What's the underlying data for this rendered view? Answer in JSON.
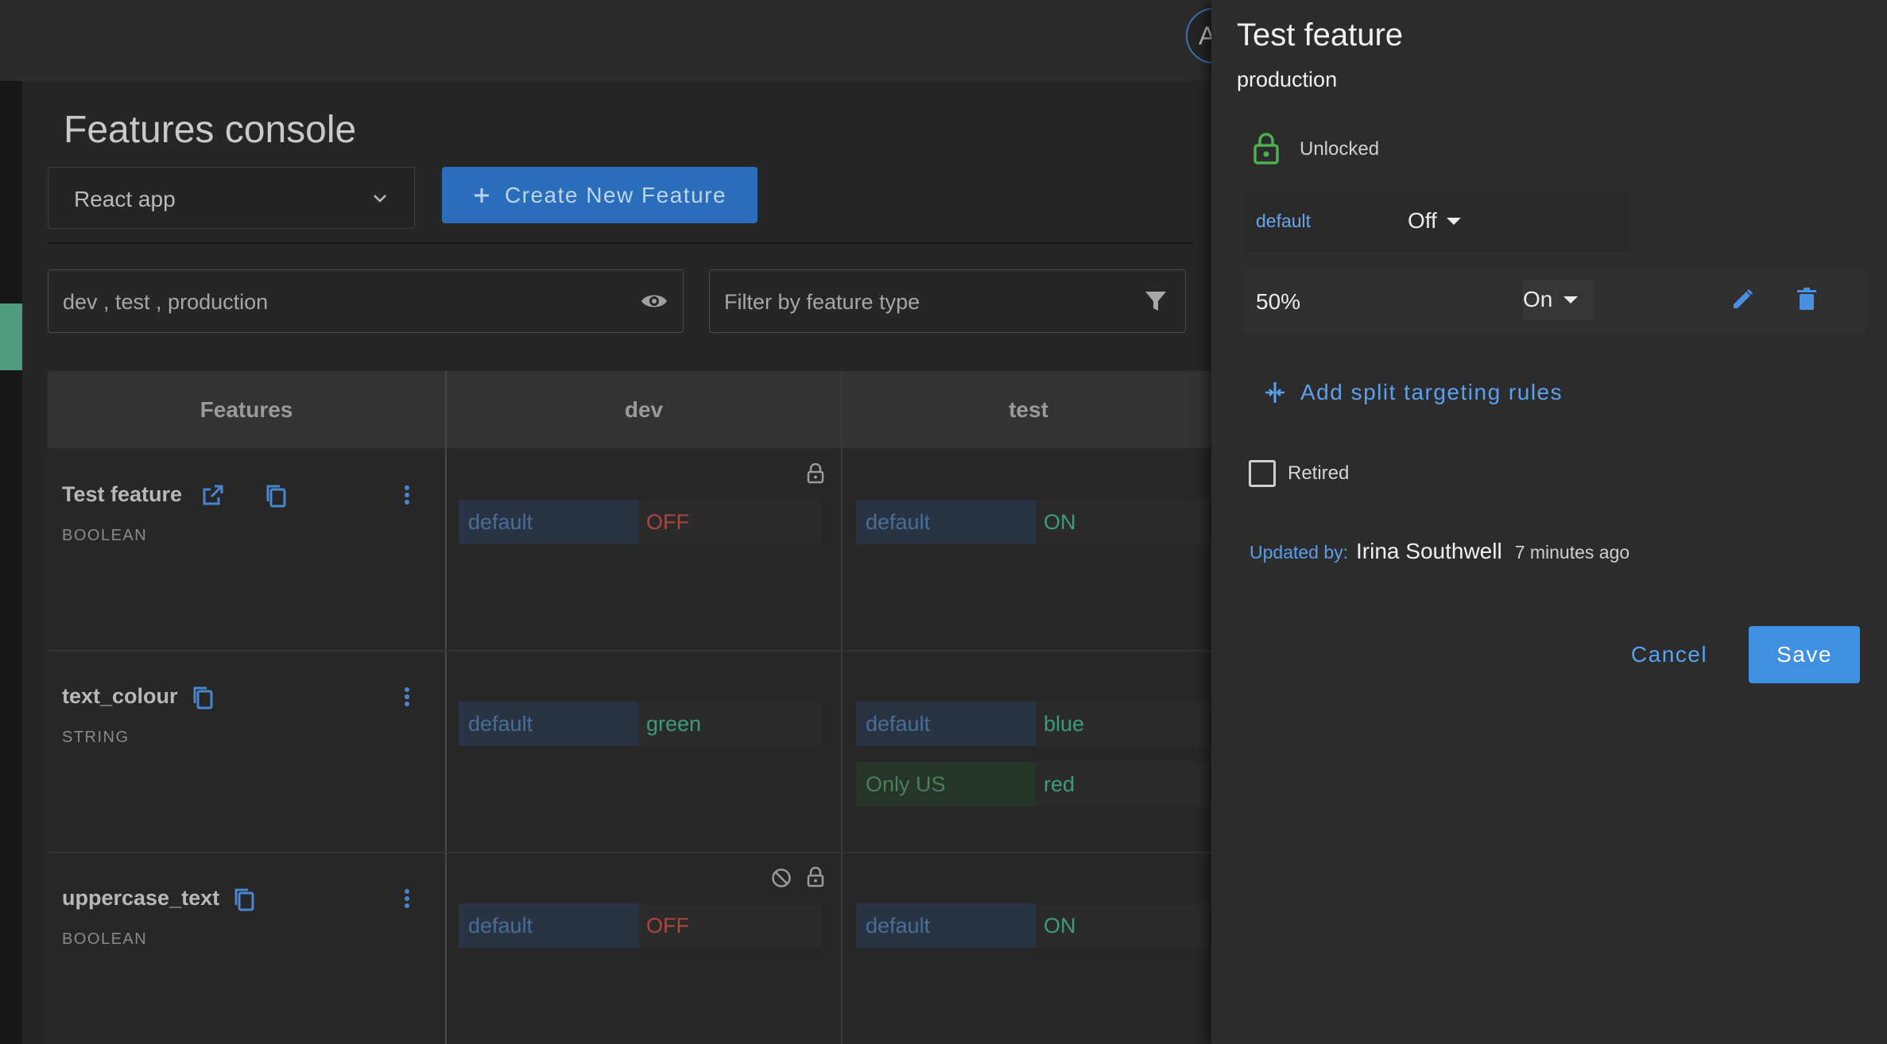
{
  "header": {
    "avatar_initial": "A"
  },
  "page": {
    "title": "Features console",
    "app_select": {
      "value": "React app"
    },
    "create_button": {
      "label": "Create New Feature"
    },
    "env_filter": {
      "value": "dev , test , production"
    },
    "type_filter": {
      "placeholder": "Filter by feature type"
    }
  },
  "table": {
    "headers": [
      "Features",
      "dev",
      "test"
    ],
    "rows": [
      {
        "name": "Test feature",
        "type": "BOOLEAN",
        "dev": [
          {
            "key": "default",
            "value": "OFF"
          }
        ],
        "test": [
          {
            "key": "default",
            "value": "ON"
          }
        ]
      },
      {
        "name": "text_colour",
        "type": "STRING",
        "dev": [
          {
            "key": "default",
            "value": "green"
          }
        ],
        "test": [
          {
            "key": "default",
            "value": "blue"
          },
          {
            "key": "Only US",
            "value": "red"
          }
        ]
      },
      {
        "name": "uppercase_text",
        "type": "BOOLEAN",
        "dev": [
          {
            "key": "default",
            "value": "OFF"
          }
        ],
        "test": [
          {
            "key": "default",
            "value": "ON"
          }
        ]
      }
    ]
  },
  "drawer": {
    "title": "Test feature",
    "environment": "production",
    "lock_status": "Unlocked",
    "default_label": "default",
    "default_value": "Off",
    "rule_percent": "50%",
    "rule_value": "On",
    "add_split_label": "Add split targeting rules",
    "retired_label": "Retired",
    "retired_checked": false,
    "updated_by_label": "Updated by:",
    "updated_by_name": "Irina Southwell",
    "updated_time": "7 minutes ago",
    "cancel_label": "Cancel",
    "save_label": "Save"
  },
  "colors": {
    "primary": "#2a6dba",
    "accent_link": "#5aa1ee",
    "on": "#3c9c7c",
    "off": "#a9463f",
    "lock_green": "#4caf50"
  },
  "icons": [
    "chevron-down-icon",
    "plus-icon",
    "eye-icon",
    "filter-icon",
    "lock-icon",
    "external-link-icon",
    "copy-icon",
    "more-vert-icon",
    "block-icon",
    "caret-down-icon",
    "pencil-icon",
    "trash-icon",
    "split-icon"
  ]
}
